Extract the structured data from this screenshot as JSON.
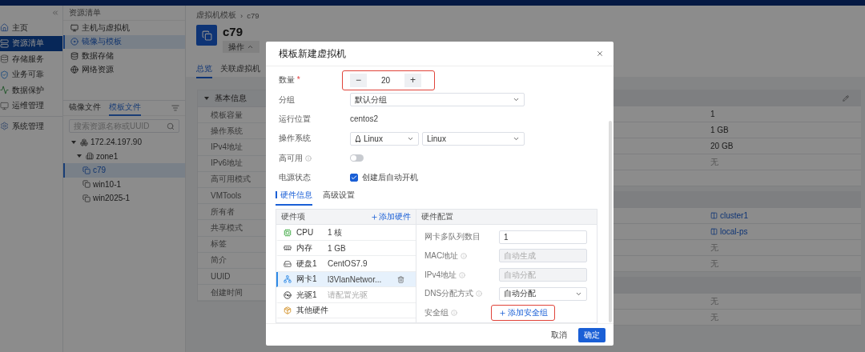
{
  "nav": {
    "items": [
      {
        "label": "主页",
        "selected": false
      },
      {
        "label": "资源清单",
        "selected": true
      },
      {
        "label": "存储服务",
        "selected": false
      },
      {
        "label": "业务可靠",
        "selected": false
      },
      {
        "label": "数据保护",
        "selected": false
      },
      {
        "label": "运维管理",
        "selected": false
      },
      {
        "label": "系统管理",
        "selected": false
      }
    ]
  },
  "resource_panel": {
    "title": "资源清单",
    "items": [
      {
        "label": "主机与虚拟机",
        "selected": false
      },
      {
        "label": "镜像与模板",
        "selected": true
      },
      {
        "label": "数据存储",
        "selected": false
      },
      {
        "label": "网络资源",
        "selected": false
      }
    ],
    "tabs": [
      {
        "label": "镜像文件",
        "selected": false
      },
      {
        "label": "模板文件",
        "selected": true
      }
    ],
    "search": {
      "placeholder": "搜索资源名称或UUID"
    },
    "tree": [
      {
        "label": "172.24.197.90",
        "kind": "host",
        "expanded": true,
        "selected": false,
        "children": [
          {
            "label": "zone1",
            "kind": "zone",
            "expanded": true,
            "selected": false,
            "children": [
              {
                "label": "c79",
                "kind": "template",
                "selected": true
              },
              {
                "label": "win10-1",
                "kind": "template",
                "selected": false
              },
              {
                "label": "win2025-1",
                "kind": "template",
                "selected": false
              }
            ]
          }
        ]
      }
    ]
  },
  "breadcrumb": [
    "虚拟机模板",
    "c79"
  ],
  "breadcrumb_separator": "›",
  "title": "c79",
  "action_button": "操作",
  "tabs": [
    {
      "label": "总览",
      "selected": true
    },
    {
      "label": "关联虚拟机",
      "selected": false
    }
  ],
  "detail_labels": [
    {
      "kind": "section",
      "label": "基本信息"
    },
    {
      "kind": "row",
      "label": "模板容量"
    },
    {
      "kind": "row",
      "label": "操作系统"
    },
    {
      "kind": "row",
      "label": "IPv4地址"
    },
    {
      "kind": "row",
      "label": "IPv6地址"
    },
    {
      "kind": "row",
      "label": "高可用模式"
    },
    {
      "kind": "row",
      "label": "VMTools"
    },
    {
      "kind": "row",
      "label": "所有者"
    },
    {
      "kind": "row",
      "label": "共享模式"
    },
    {
      "kind": "row",
      "label": "标签"
    },
    {
      "kind": "row",
      "label": "简介"
    },
    {
      "kind": "row",
      "label": "UUID"
    },
    {
      "kind": "row",
      "label": "创建时间"
    }
  ],
  "detail_values": [
    {
      "kind": "section"
    },
    {
      "kind": "row",
      "value": "1"
    },
    {
      "kind": "row",
      "value": "1 GB"
    },
    {
      "kind": "row",
      "value": "20 GB"
    },
    {
      "kind": "muted",
      "value": "无"
    },
    {
      "kind": "row"
    },
    {
      "kind": "section"
    },
    {
      "kind": "link",
      "value": "cluster1"
    },
    {
      "kind": "link",
      "value": "local-ps"
    },
    {
      "kind": "muted",
      "value": "无"
    },
    {
      "kind": "muted",
      "value": "无"
    },
    {
      "kind": "section"
    },
    {
      "kind": "muted",
      "value": "无"
    },
    {
      "kind": "muted",
      "value": "无"
    }
  ],
  "dialog": {
    "title": "模板新建虚拟机",
    "quantity": {
      "label": "数量",
      "required_mark": "*",
      "value": "20",
      "minus": "−",
      "plus": "+",
      "highlighted": true
    },
    "group": {
      "label": "分组",
      "value": "默认分组"
    },
    "location": {
      "label": "运行位置",
      "value": "centos2"
    },
    "os": {
      "label": "操作系统",
      "type": "Linux",
      "version": "Linux"
    },
    "ha": {
      "label": "高可用",
      "on": false
    },
    "power": {
      "label": "电源状态",
      "option": "创建后自动开机",
      "checked": true
    },
    "tabs": [
      {
        "label": "硬件信息",
        "selected": true
      },
      {
        "label": "高级设置",
        "selected": false
      }
    ],
    "hardware": {
      "header": "硬件项",
      "add": "添加硬件",
      "items": [
        {
          "name": "CPU",
          "value": "1 核",
          "muted": false,
          "selected": false
        },
        {
          "name": "内存",
          "value": "1 GB",
          "muted": false,
          "selected": false
        },
        {
          "name": "硬盘1",
          "value": "CentOS7.9",
          "muted": false,
          "selected": false
        },
        {
          "name": "网卡1",
          "value": "l3VlanNetwor...",
          "muted": false,
          "selected": true
        },
        {
          "name": "光驱1",
          "value": "请配置光驱",
          "muted": true,
          "selected": false
        },
        {
          "name": "其他硬件",
          "selected": false
        }
      ]
    },
    "config": {
      "header": "硬件配置",
      "fields": [
        {
          "label": "网卡多队列数目",
          "kind": "input",
          "value": "1",
          "info": false
        },
        {
          "label": "MAC地址",
          "kind": "disabled",
          "placeholder": "自动生成",
          "info": true
        },
        {
          "label": "IPv4地址",
          "kind": "disabled",
          "placeholder": "自动分配",
          "info": true
        },
        {
          "label": "DNS分配方式",
          "kind": "select",
          "value": "自动分配",
          "info": true
        },
        {
          "label": "安全组",
          "kind": "add",
          "value": "添加安全组",
          "info": true,
          "highlighted": true
        }
      ]
    },
    "cancel": "取消",
    "confirm": "确定"
  }
}
